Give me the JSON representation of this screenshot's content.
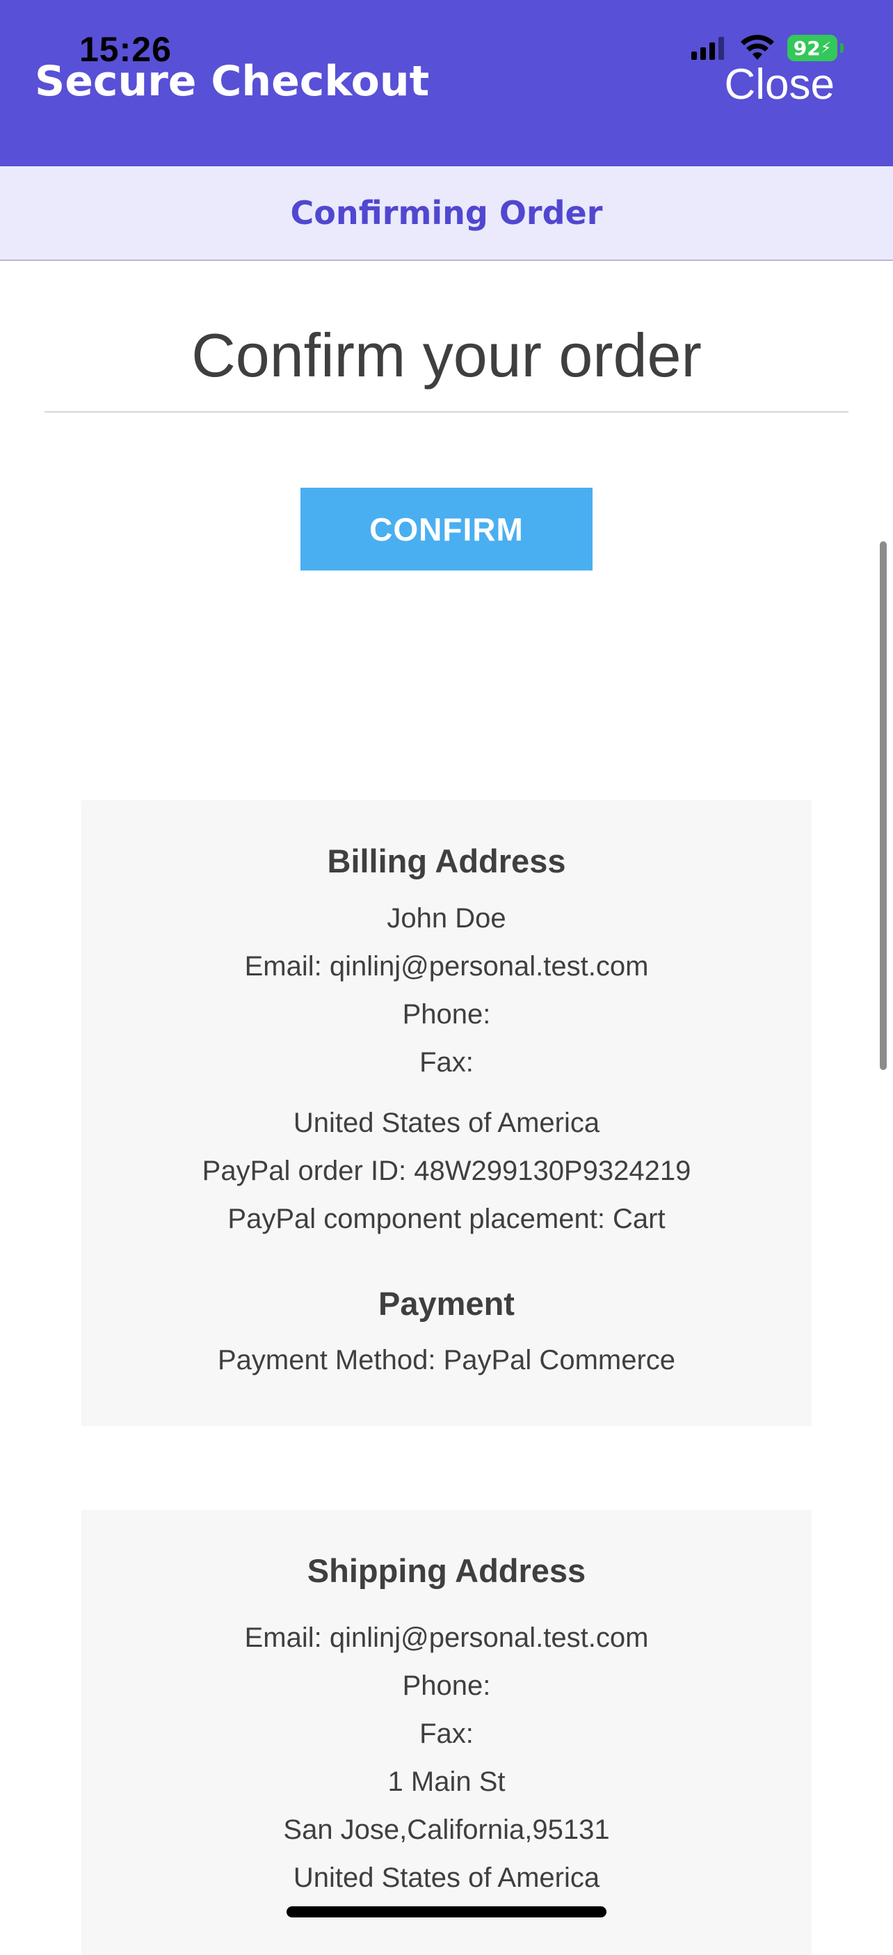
{
  "status_bar": {
    "time": "15:26",
    "battery": "92",
    "icons": [
      "signal-icon",
      "wifi-icon",
      "battery-icon"
    ]
  },
  "header": {
    "title": "Secure Checkout",
    "close_label": "Close",
    "color": "#5850d6"
  },
  "subheader": {
    "title": "Confirming Order"
  },
  "main": {
    "heading": "Confirm your order",
    "confirm_label": "CONFIRM",
    "confirm_color": "#4aaff0"
  },
  "billing": {
    "title": "Billing Address",
    "name": "John Doe",
    "email": "Email: qinlinj@personal.test.com",
    "phone": "Phone:",
    "fax": "Fax:",
    "country": "United States of America",
    "order_id": "PayPal order ID: 48W299130P9324219",
    "placement": "PayPal component placement: Cart"
  },
  "payment": {
    "title": "Payment",
    "method": "Payment Method: PayPal Commerce"
  },
  "shipping": {
    "title": "Shipping Address",
    "email": "Email: qinlinj@personal.test.com",
    "phone": "Phone:",
    "fax": "Fax:",
    "street": "1 Main St",
    "city": "San Jose,California,95131",
    "country": "United States of America"
  }
}
